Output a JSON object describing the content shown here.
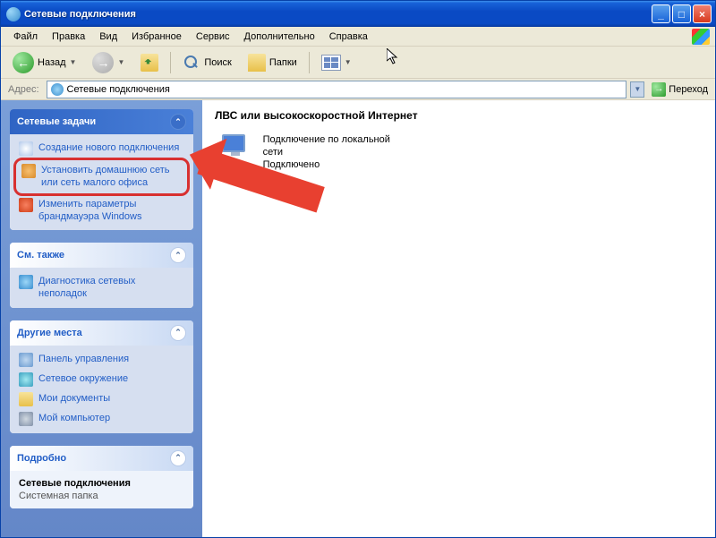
{
  "window": {
    "title": "Сетевые подключения"
  },
  "menu": {
    "file": "Файл",
    "edit": "Правка",
    "view": "Вид",
    "favorites": "Избранное",
    "tools": "Сервис",
    "advanced": "Дополнительно",
    "help": "Справка"
  },
  "toolbar": {
    "back": "Назад",
    "search": "Поиск",
    "folders": "Папки"
  },
  "address": {
    "label": "Адрес:",
    "value": "Сетевые подключения",
    "go": "Переход"
  },
  "sidebar": {
    "tasks_title": "Сетевые задачи",
    "tasks": [
      {
        "label": "Создание нового подключения"
      },
      {
        "label": "Установить домашнюю сеть или сеть малого офиса"
      },
      {
        "label": "Изменить параметры брандмауэра Windows"
      }
    ],
    "see_also_title": "См. также",
    "see_also": [
      {
        "label": "Диагностика сетевых неполадок"
      }
    ],
    "places_title": "Другие места",
    "places": [
      {
        "label": "Панель управления"
      },
      {
        "label": "Сетевое окружение"
      },
      {
        "label": "Мои документы"
      },
      {
        "label": "Мой компьютер"
      }
    ],
    "details_title": "Подробно",
    "details_name": "Сетевые подключения",
    "details_type": "Системная папка"
  },
  "content": {
    "section": "ЛВС или высокоскоростной Интернет",
    "connection_name": "Подключение по локальной сети",
    "connection_status": "Подключено"
  }
}
